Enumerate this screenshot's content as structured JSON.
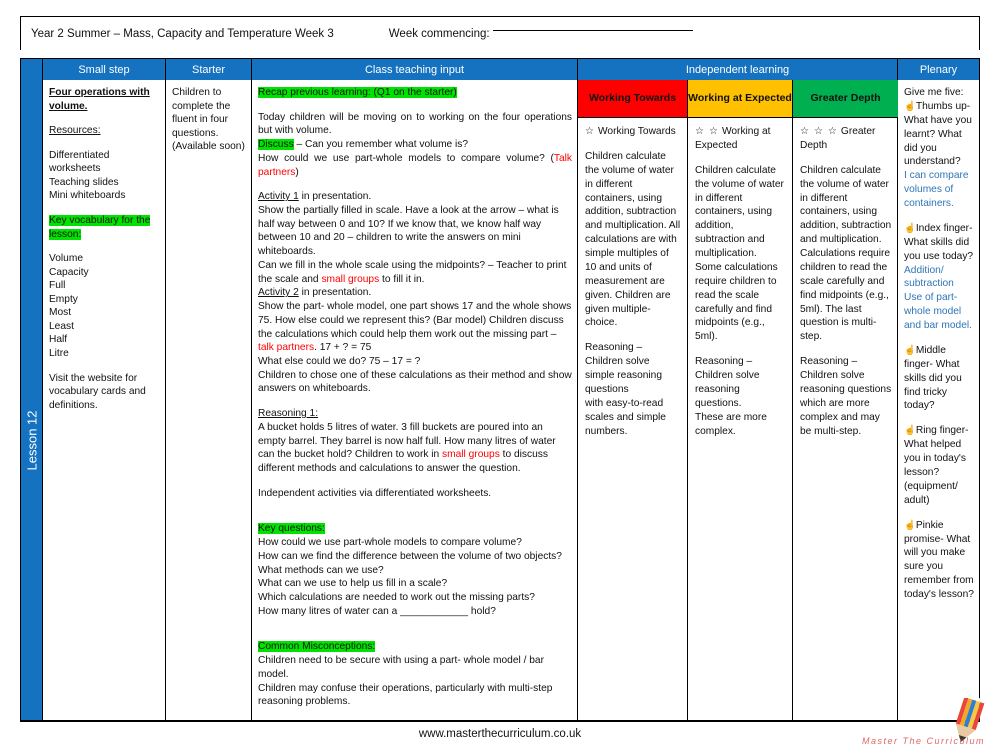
{
  "header": {
    "title": "Year 2 Summer – Mass, Capacity and Temperature Week 3",
    "week_commencing_label": "Week commencing:"
  },
  "lesson_label": "Lesson 12",
  "columns": {
    "small_step": "Small step",
    "starter": "Starter",
    "class_teaching_input": "Class teaching input",
    "independent_learning": "Independent learning",
    "plenary": "Plenary"
  },
  "small_step": {
    "title": "Four operations with volume.",
    "resources_label": "Resources:",
    "resources": [
      "Differentiated worksheets",
      "Teaching slides",
      "Mini whiteboards"
    ],
    "key_vocab_label": "Key vocabulary for the lesson:",
    "vocabulary": [
      "Volume",
      "Capacity",
      "Full",
      "Empty",
      "Most",
      "Least",
      "Half",
      "Litre"
    ],
    "footer_note": "Visit the website for vocabulary cards and definitions."
  },
  "starter": {
    "text": "Children to complete the fluent in four questions. (Available soon)"
  },
  "teaching_input": {
    "recap_heading": "Recap previous learning:",
    "recap_suffix": " (Q1 on the starter)",
    "intro": "Today children will be moving on to working on the four operations but with volume.",
    "discuss_label": "Discuss",
    "discuss_text": " – Can you remember what volume is?",
    "discuss_q2_pre": "How could we use part-whole models to compare volume? (",
    "discuss_q2_red": "Talk partners",
    "discuss_q2_post": ")",
    "activity1_label": "Activity 1",
    "activity1_suffix": " in presentation.",
    "activity1_body": "Show the partially filled in scale. Have a look at the arrow – what is half way between 0 and 10? If we know that, we know half way between 10 and 20 – children to write the answers on mini whiteboards.",
    "activity1_body2_pre": "Can we fill in the whole scale using the midpoints? – Teacher to print the scale and ",
    "activity1_body2_red": "small groups",
    "activity1_body2_post": " to fill it in.",
    "activity2_label": "Activity 2",
    "activity2_suffix": " in presentation.",
    "activity2_body_pre": "Show the part- whole model, one part shows 17 and the whole shows 75. How else could we represent this? (Bar model) Children discuss the calculations which could help them work out the missing part – ",
    "activity2_red": "talk partners",
    "activity2_body_post": ". 17 + ? = 75",
    "activity2_line2": "What else could we do? 75 – 17 = ?",
    "activity2_line3": "Children to chose one of these calculations as their method and show answers on whiteboards.",
    "reasoning_label": "Reasoning 1:",
    "reasoning_pre": "A bucket holds 5 litres of water. 3 fill buckets are poured into an empty barrel. They barrel is now half full. How many litres of water can the bucket hold? Children to work in ",
    "reasoning_red": "small groups",
    "reasoning_post": " to discuss different methods and calculations to answer the question.",
    "independent_note": "Independent activities via differentiated worksheets.",
    "key_questions_label": "Key questions:",
    "key_questions": [
      "How could we use part-whole models to compare volume?",
      "How can we find the difference between the volume of two objects?",
      "What methods can we use?",
      "What can we use to help us fill in a scale?",
      "Which calculations are needed to work out the missing parts?",
      "How many litres of water can a ____________ hold?"
    ],
    "misconceptions_label": "Common Misconceptions:",
    "misconceptions": [
      "Children need to be secure with using a part- whole model / bar model.",
      "Children may confuse their operations, particularly with multi-step reasoning problems."
    ]
  },
  "independent": {
    "working_towards": {
      "header": "Working Towards",
      "header_color": "#ff0000",
      "stars": "☆",
      "star_label": "Working Towards",
      "body": "Children calculate the volume of water in different containers, using addition, subtraction and multiplication. All calculations are with simple multiples of 10 and units of measurement are given. Children are given multiple-choice.",
      "reasoning": "Reasoning – Children solve simple reasoning questions",
      "reasoning2": "with easy-to-read scales and simple numbers."
    },
    "working_at_expected": {
      "header": "Working at Expected",
      "header_color": "#ffc000",
      "stars": "☆ ☆",
      "star_label": "Working at Expected",
      "body": "Children calculate the volume of water in different containers, using addition, subtraction and multiplication. Some calculations require children to read the scale carefully and find midpoints (e.g., 5ml).",
      "reasoning": "Reasoning – Children solve reasoning questions.",
      "reasoning2": "These are more complex."
    },
    "greater_depth": {
      "header": "Greater Depth",
      "header_color": "#00b050",
      "stars": "☆ ☆ ☆",
      "star_label": "Greater Depth",
      "body": "Children calculate the volume of water in different containers, using addition, subtraction and multiplication. Calculations require children to read the scale carefully and find midpoints (e.g., 5ml). The last question is multi-step.",
      "reasoning": "Reasoning – Children solve reasoning questions which are more complex and may be multi-step."
    }
  },
  "plenary": {
    "intro": "Give me five:",
    "items": [
      {
        "icon": "hand-icon",
        "question": "Thumbs up- What have you learnt? What did you understand?",
        "answer": "I can compare volumes of containers."
      },
      {
        "icon": "hand-icon",
        "question": "Index finger- What skills did you use today?",
        "answer": "Addition/ subtraction Use of part-whole model and bar model."
      },
      {
        "icon": "hand-icon",
        "question": "Middle finger- What skills did you find tricky today?",
        "answer": ""
      },
      {
        "icon": "hand-icon",
        "question": "Ring finger- What helped you in today's lesson? (equipment/ adult)",
        "answer": ""
      },
      {
        "icon": "hand-icon",
        "question": "Pinkie promise- What will you make sure you remember from today's lesson?",
        "answer": ""
      }
    ]
  },
  "footer": {
    "url": "www.masterthecurriculum.co.uk",
    "brand": "Master  The  Curriculum"
  },
  "colors": {
    "brand_blue": "#1572c0",
    "highlight_green": "#00e300",
    "red_text": "#ff0000",
    "blue_answer": "#2e75b6"
  }
}
